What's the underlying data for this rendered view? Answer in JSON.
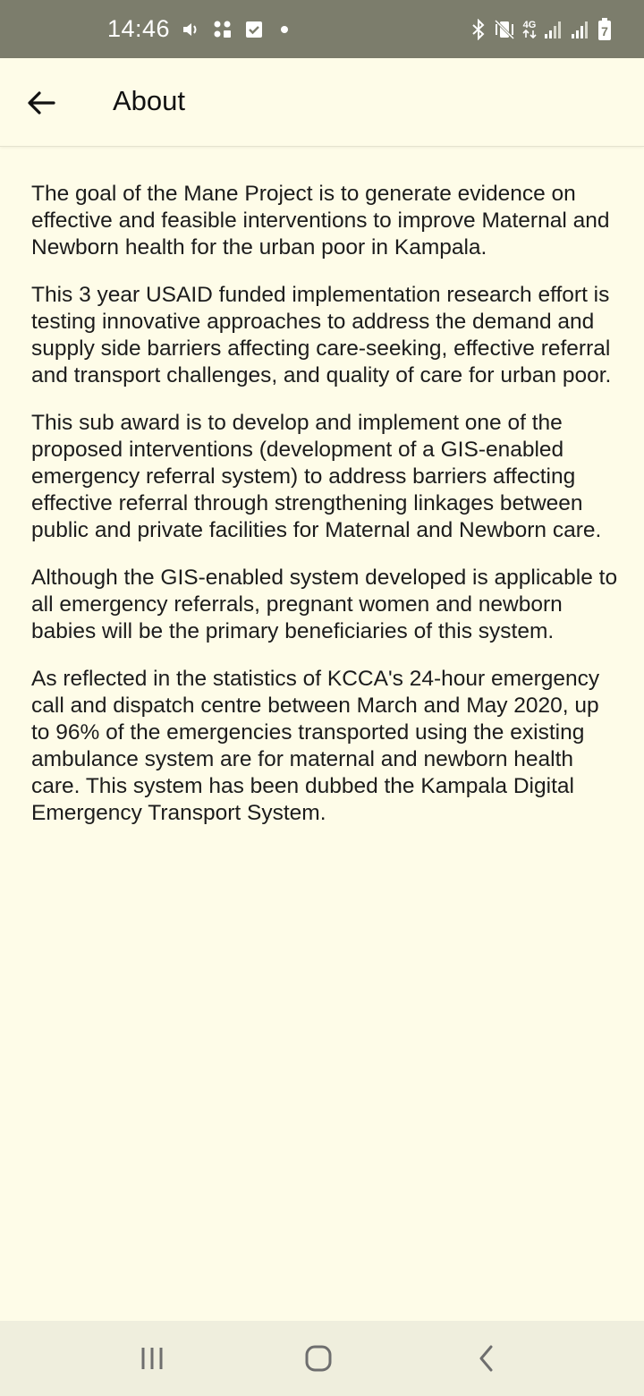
{
  "status_bar": {
    "time": "14:46",
    "network_label": "4G",
    "battery_level": "7",
    "left_icons": [
      "volume-icon",
      "apps-grid-icon",
      "checkbox-icon",
      "dot-icon"
    ],
    "right_icons": [
      "bluetooth-icon",
      "vibrate-mute-icon",
      "network-4g-icon",
      "signal-icon",
      "signal-icon",
      "battery-icon"
    ]
  },
  "app_bar": {
    "title": "About",
    "back_icon": "arrow-back-icon"
  },
  "content": {
    "paragraphs": [
      "The goal of the Mane Project is to generate evidence on effective and feasible interventions to improve Maternal and Newborn health for the urban poor in Kampala.",
      "This 3 year USAID funded implementation research effort is testing innovative approaches to address the demand and supply side barriers affecting care-seeking, effective referral and transport challenges, and quality of care for urban poor.",
      "This sub award is to develop and implement one of the proposed interventions (development of a GIS-enabled emergency referral system) to address barriers affecting effective referral through strengthening linkages between public and private facilities for Maternal and Newborn care.",
      "Although the GIS-enabled system developed is applicable to all emergency referrals, pregnant women and newborn babies will be the primary beneficiaries of this system.",
      "As reflected in the statistics of KCCA's 24-hour emergency call and dispatch centre between March and May 2020, up to 96% of the emergencies transported using the existing ambulance system are for maternal and newborn health care. This system has been dubbed the Kampala Digital Emergency Transport System."
    ]
  },
  "nav_bar": {
    "buttons": [
      "recent-apps-icon",
      "home-icon",
      "back-icon"
    ]
  },
  "colors": {
    "background": "#fefce8",
    "status_bar": "#7c7d6c",
    "nav_bar": "#efeedd",
    "text": "#1c1c1c"
  }
}
